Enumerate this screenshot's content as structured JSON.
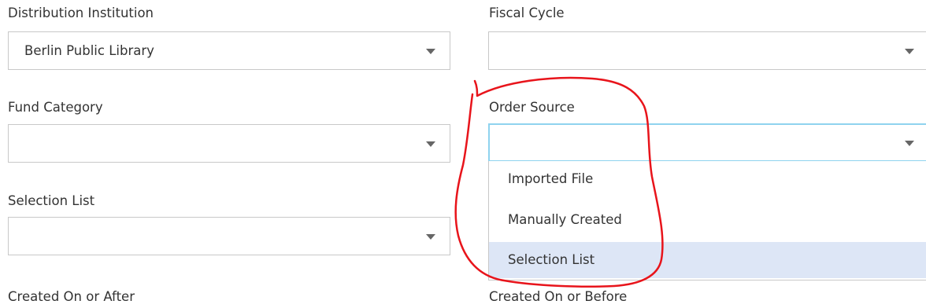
{
  "fields": {
    "distribution_institution": {
      "label": "Distribution Institution",
      "value": "Berlin Public Library"
    },
    "fiscal_cycle": {
      "label": "Fiscal Cycle",
      "value": ""
    },
    "fund_category": {
      "label": "Fund Category",
      "value": ""
    },
    "order_source": {
      "label": "Order Source",
      "value": "",
      "options": [
        "Imported File",
        "Manually Created",
        "Selection List"
      ],
      "highlighted_option": "Selection List"
    },
    "selection_list": {
      "label": "Selection List",
      "value": ""
    },
    "created_on_or_after": {
      "label": "Created On or After"
    },
    "created_on_or_before": {
      "label": "Created On or Before"
    }
  },
  "colors": {
    "text": "#333333",
    "border": "#c8c8c8",
    "focus_border": "#8fd3ef",
    "option_highlight": "#dde6f6",
    "annotation": "#e8141b"
  },
  "icons": {
    "dropdown_caret": "chevron-down-icon"
  }
}
